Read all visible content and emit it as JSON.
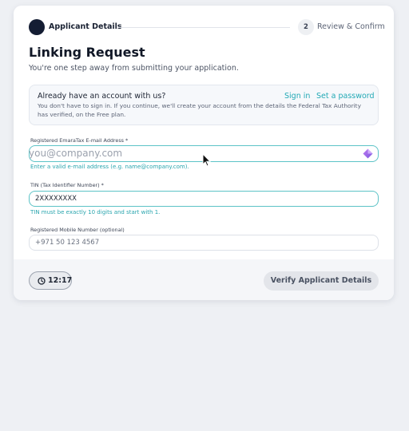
{
  "stepper": {
    "step1_label": "Applicant Details",
    "step2_number": "2",
    "step2_label": "Review & Confirm"
  },
  "page": {
    "title": "Linking Request",
    "subtitle": "You're one step away from submitting your application."
  },
  "account_box": {
    "question": "Already have an account with us?",
    "sign_in_label": "Sign in",
    "set_password_label": "Set a password",
    "body": "You don't have to sign in. If you continue, we'll create your account from the details the Federal Tax Authority has verified, on the Free plan."
  },
  "form": {
    "email": {
      "label": "Registered EmaraTax E-mail Address *",
      "placeholder": "you@company.com",
      "help": "Enter a valid e-mail address (e.g. name@company.com)."
    },
    "tin": {
      "label": "TIN (Tax Identifier Number) *",
      "value": "2XXXXXXXX",
      "help": "TIN must be exactly 10 digits and start with 1."
    },
    "mobile": {
      "label": "Registered Mobile Number (optional)",
      "placeholder": "+971 50 123 4567"
    }
  },
  "footer": {
    "timer": "12:17",
    "verify_label": "Verify Applicant Details"
  },
  "colors": {
    "accent": "#22a9b5",
    "focus_border": "#5dc3c7",
    "dark_step": "#141d33"
  },
  "icons": [
    "clock-icon",
    "gem-icon",
    "mouse-cursor-icon"
  ]
}
